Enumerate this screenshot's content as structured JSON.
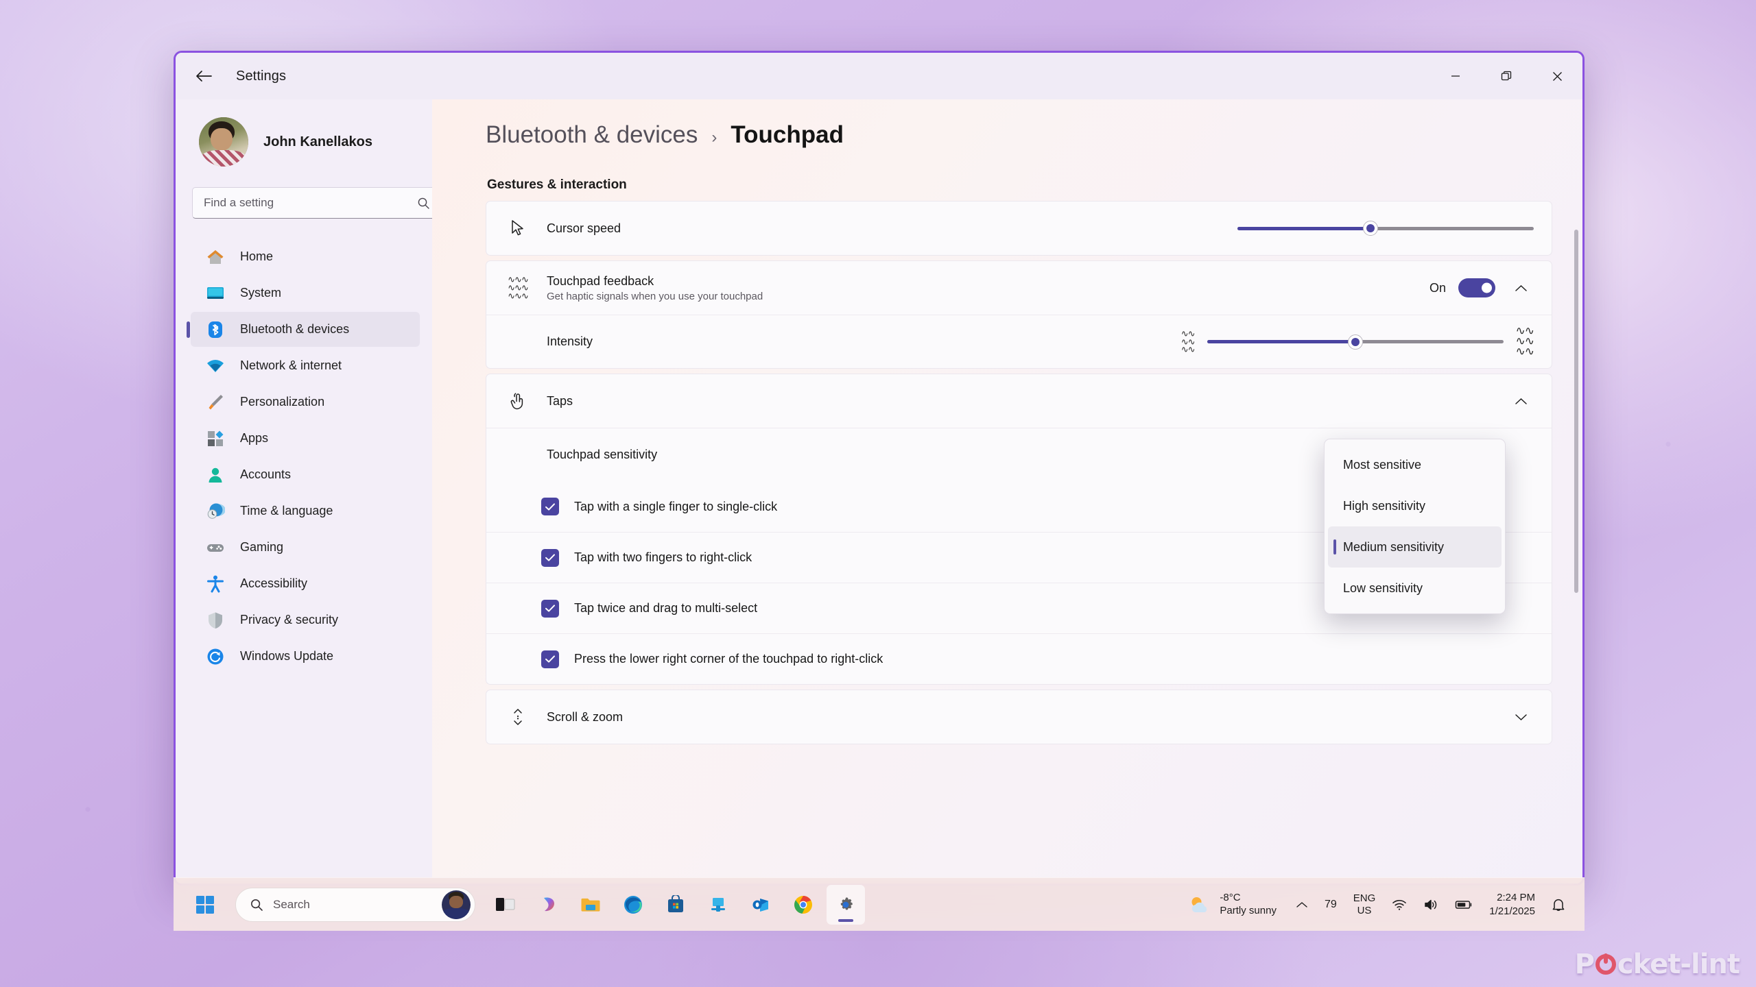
{
  "window": {
    "title": "Settings",
    "back_icon": "back-arrow-icon",
    "minimize_label": "Minimize",
    "maximize_label": "Restore",
    "close_label": "Close"
  },
  "sidebar": {
    "account_name": "John Kanellakos",
    "search_placeholder": "Find a setting",
    "search_value": "",
    "search_icon": "search-icon",
    "items": [
      {
        "label": "Home",
        "icon": "home-icon",
        "active": false
      },
      {
        "label": "System",
        "icon": "system-monitor-icon",
        "active": false
      },
      {
        "label": "Bluetooth & devices",
        "icon": "bluetooth-icon",
        "active": true
      },
      {
        "label": "Network & internet",
        "icon": "wifi-icon",
        "active": false
      },
      {
        "label": "Personalization",
        "icon": "paintbrush-icon",
        "active": false
      },
      {
        "label": "Apps",
        "icon": "apps-grid-icon",
        "active": false
      },
      {
        "label": "Accounts",
        "icon": "person-icon",
        "active": false
      },
      {
        "label": "Time & language",
        "icon": "clock-globe-icon",
        "active": false
      },
      {
        "label": "Gaming",
        "icon": "gamepad-icon",
        "active": false
      },
      {
        "label": "Accessibility",
        "icon": "accessibility-person-icon",
        "active": false
      },
      {
        "label": "Privacy & security",
        "icon": "shield-icon",
        "active": false
      },
      {
        "label": "Windows Update",
        "icon": "refresh-sync-icon",
        "active": false
      }
    ]
  },
  "breadcrumb": {
    "parent": "Bluetooth & devices",
    "separator": "›",
    "current": "Touchpad"
  },
  "main": {
    "section_title": "Gestures & interaction",
    "cursor_speed": {
      "label": "Cursor speed",
      "icon": "cursor-arrow-icon",
      "value_percent": 45
    },
    "touchpad_feedback": {
      "label": "Touchpad feedback",
      "sublabel": "Get haptic signals when you use your touchpad",
      "icon": "haptic-waves-icon",
      "toggle_state": "On",
      "expanded": true,
      "chevron": "chevron-up-icon"
    },
    "intensity": {
      "label": "Intensity",
      "value_percent": 50,
      "low_icon": "haptic-low-icon",
      "high_icon": "haptic-high-icon"
    },
    "taps": {
      "label": "Taps",
      "icon": "tap-hand-icon",
      "expanded": true,
      "chevron": "chevron-up-icon"
    },
    "touchpad_sensitivity": {
      "label": "Touchpad sensitivity"
    },
    "checkboxes": [
      {
        "label": "Tap with a single finger to single-click",
        "checked": true
      },
      {
        "label": "Tap with two fingers to right-click",
        "checked": true
      },
      {
        "label": "Tap twice and drag to multi-select",
        "checked": true
      },
      {
        "label": "Press the lower right corner of the touchpad to right-click",
        "checked": true
      }
    ],
    "scroll_zoom": {
      "label": "Scroll & zoom",
      "icon": "scroll-updown-icon",
      "expanded": false,
      "chevron": "chevron-down-icon"
    }
  },
  "dropdown": {
    "open": true,
    "options": [
      {
        "label": "Most sensitive",
        "selected": false
      },
      {
        "label": "High sensitivity",
        "selected": false
      },
      {
        "label": "Medium sensitivity",
        "selected": true
      },
      {
        "label": "Low sensitivity",
        "selected": false
      }
    ]
  },
  "taskbar": {
    "start_icon": "windows-start-icon",
    "search_placeholder": "Search",
    "search_icon": "search-icon",
    "apps": [
      {
        "name": "task-view-icon",
        "active": false
      },
      {
        "name": "copilot-icon",
        "active": false
      },
      {
        "name": "file-explorer-icon",
        "active": false
      },
      {
        "name": "microsoft-edge-icon",
        "active": false
      },
      {
        "name": "microsoft-store-icon",
        "active": false
      },
      {
        "name": "teams-icon",
        "active": false
      },
      {
        "name": "outlook-icon",
        "active": false
      },
      {
        "name": "google-chrome-icon",
        "active": false
      },
      {
        "name": "settings-gear-icon",
        "active": true
      }
    ],
    "weather": {
      "temperature": "-8°C",
      "condition": "Partly sunny",
      "icon": "partly-sunny-icon"
    },
    "tray": {
      "chevron_icon": "chevron-up-icon",
      "badge_count": "79",
      "language_line1": "ENG",
      "language_line2": "US",
      "wifi_icon": "wifi-icon",
      "volume_icon": "speaker-icon",
      "battery_icon": "battery-icon",
      "time": "2:24 PM",
      "date": "1/21/2025",
      "notification_icon": "bell-icon"
    }
  },
  "watermark": {
    "text_before": "P",
    "text_after": "cket-lint"
  },
  "colors": {
    "accent": "#4a44a0",
    "window_border": "#8b52e0",
    "sidebar_bg": "#f3eef8",
    "selection_bar": "#5b53a8"
  }
}
